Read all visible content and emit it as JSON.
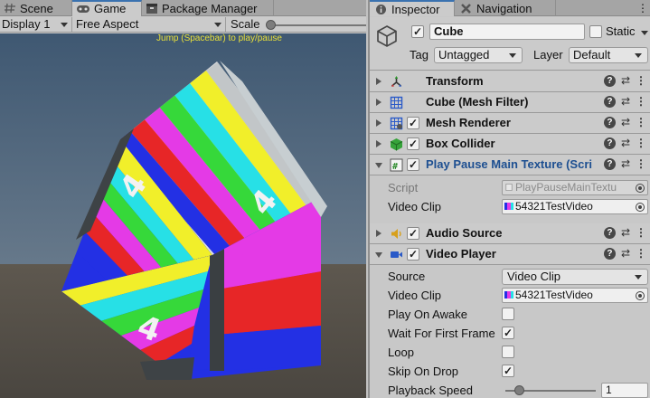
{
  "game_panel": {
    "tabs": [
      {
        "label": "Scene",
        "icon": "hash-grid-icon"
      },
      {
        "label": "Game",
        "icon": "gamepad-icon"
      },
      {
        "label": "Package Manager",
        "icon": "package-icon"
      }
    ],
    "display": "Display 1",
    "aspect": "Free Aspect",
    "scale_label": "Scale",
    "hint": "Jump (Spacebar) to play/pause",
    "cube_face_label": "4"
  },
  "inspector": {
    "tabs": [
      {
        "label": "Inspector",
        "icon": "info-icon"
      },
      {
        "label": "Navigation",
        "icon": "navigation-icon"
      }
    ],
    "object": {
      "name": "Cube",
      "active": true,
      "static_label": "Static",
      "static": false,
      "tag_label": "Tag",
      "tag": "Untagged",
      "layer_label": "Layer",
      "layer": "Default"
    },
    "components": {
      "transform": {
        "title": "Transform",
        "icon": "transform-icon"
      },
      "mesh_filter": {
        "title": "Cube (Mesh Filter)",
        "icon": "mesh-filter-icon"
      },
      "mesh_renderer": {
        "title": "Mesh Renderer",
        "icon": "mesh-renderer-icon",
        "enabled": true
      },
      "box_collider": {
        "title": "Box Collider",
        "icon": "box-collider-icon",
        "enabled": true
      },
      "play_pause": {
        "title": "Play Pause Main Texture (Scri",
        "icon": "script-icon",
        "enabled": true,
        "script_label": "Script",
        "script_value": "PlayPauseMainTextu",
        "video_clip_label": "Video Clip",
        "video_clip_value": "54321TestVideo"
      },
      "audio_source": {
        "title": "Audio Source",
        "icon": "audio-source-icon",
        "enabled": true
      },
      "video_player": {
        "title": "Video Player",
        "icon": "video-player-icon",
        "enabled": true,
        "source_label": "Source",
        "source_value": "Video Clip",
        "video_clip_label": "Video Clip",
        "video_clip_value": "54321TestVideo",
        "play_on_awake_label": "Play On Awake",
        "play_on_awake": false,
        "wait_first_frame_label": "Wait For First Frame",
        "wait_first_frame": true,
        "loop_label": "Loop",
        "loop": false,
        "skip_on_drop_label": "Skip On Drop",
        "skip_on_drop": true,
        "playback_speed_label": "Playback Speed",
        "playback_speed": "1"
      }
    },
    "colors": {
      "accent": "#3a72b0",
      "title_blue": "#1d4f91"
    }
  }
}
